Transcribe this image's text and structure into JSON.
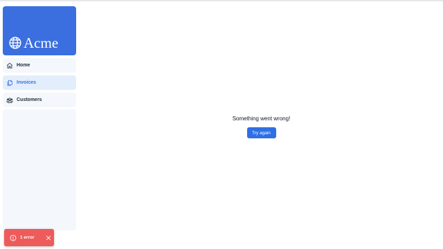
{
  "sidebar": {
    "brand": {
      "name": "Acme",
      "icon": "globe-icon",
      "color": "#3b6fe0"
    },
    "items": [
      {
        "label": "Home",
        "icon": "home-icon",
        "active": false
      },
      {
        "label": "Invoices",
        "icon": "document-icon",
        "active": true
      },
      {
        "label": "Customers",
        "icon": "users-icon",
        "active": false
      }
    ]
  },
  "main": {
    "error_message": "Something went wrong!",
    "retry_label": "Try again"
  },
  "toast": {
    "label": "1 error",
    "icon": "error-circle-icon",
    "close_icon": "close-icon",
    "color": "#ee5b5b"
  },
  "colors": {
    "accent": "#2f6fe5",
    "nav_bg": "#f4f7fb",
    "nav_active_bg": "#e3eefc"
  }
}
